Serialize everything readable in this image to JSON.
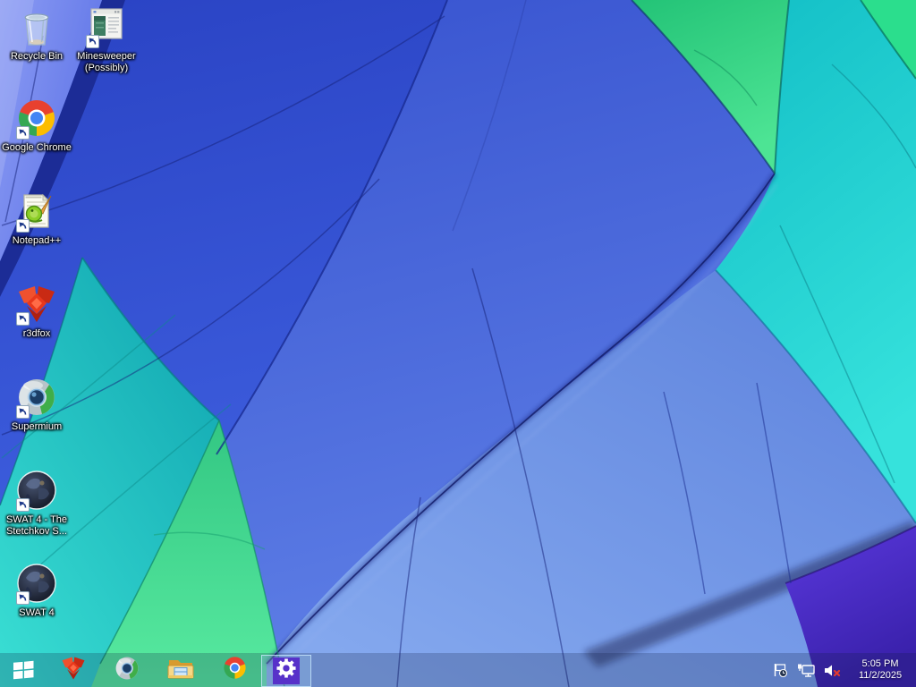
{
  "wallpaper": {
    "name": "hot-air-balloon-canopy",
    "palette": {
      "periwinkle": "#5D72E8",
      "navy_seam": "#1C2C96",
      "royal_blue": "#2B46C8",
      "cornflower": "#3E5EDC",
      "teal_left": "#14AEB4",
      "mint_green": "#45DE92",
      "green_top": "#2BD980",
      "teal_right": "#1EC8CC",
      "steel_blue": "#6F96E0",
      "purple_corner": "#4A2EC8"
    }
  },
  "desktop": {
    "icons": [
      {
        "label": "Recycle Bin",
        "icon": "recycle-bin-icon",
        "shortcut": false
      },
      {
        "label": "Minesweeper (Possibly)",
        "icon": "minesweeper-icon",
        "shortcut": true
      },
      {
        "label": "Google Chrome",
        "icon": "chrome-icon",
        "shortcut": true
      },
      {
        "label": "Notepad++",
        "icon": "notepadpp-icon",
        "shortcut": true
      },
      {
        "label": "r3dfox",
        "icon": "r3dfox-icon",
        "shortcut": true
      },
      {
        "label": "Supermium",
        "icon": "supermium-icon",
        "shortcut": true
      },
      {
        "label": "SWAT 4 - The Stetchkov S...",
        "icon": "swat4-icon",
        "shortcut": true
      },
      {
        "label": "SWAT 4",
        "icon": "swat4-icon",
        "shortcut": true
      }
    ]
  },
  "taskbar": {
    "buttons": [
      {
        "id": "start",
        "icon": "windows-start-icon"
      },
      {
        "id": "r3dfox",
        "icon": "r3dfox-icon"
      },
      {
        "id": "supermium",
        "icon": "supermium-icon"
      },
      {
        "id": "file-explorer",
        "icon": "file-explorer-icon"
      },
      {
        "id": "google-chrome",
        "icon": "chrome-icon"
      },
      {
        "id": "settings",
        "icon": "gear-icon",
        "active": true,
        "tile_color": "#5731C9"
      }
    ],
    "tray": {
      "icons": [
        {
          "id": "action-center",
          "icon": "flag-clock-icon"
        },
        {
          "id": "network",
          "icon": "network-icon"
        },
        {
          "id": "volume",
          "icon": "volume-muted-icon"
        }
      ],
      "clock": {
        "time": "5:05 PM",
        "date": "11/2/2025"
      }
    }
  }
}
